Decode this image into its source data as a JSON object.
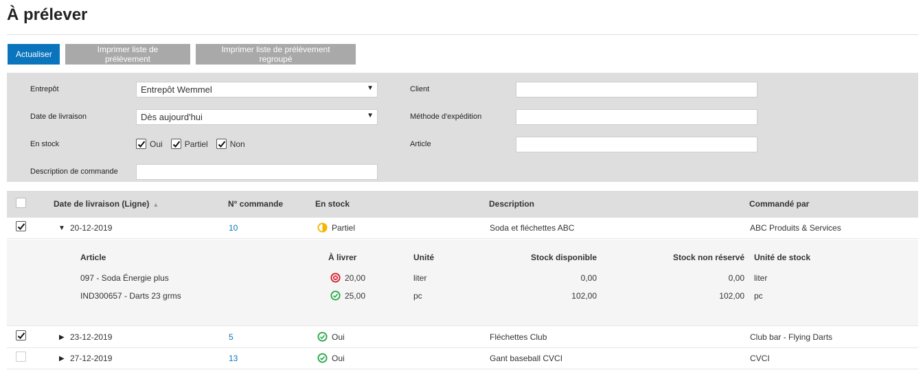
{
  "page": {
    "title": "À prélever"
  },
  "toolbar": {
    "refresh_label": "Actualiser",
    "print_label": "Imprimer liste de prélèvement",
    "print_grouped_label": "Imprimer liste de prélèvement regroupé"
  },
  "filters": {
    "warehouse": {
      "label": "Entrepôt",
      "value": "Entrepôt Wemmel"
    },
    "delivery_date": {
      "label": "Date de livraison",
      "value": "Dès aujourd'hui"
    },
    "in_stock": {
      "label": "En stock",
      "options": [
        {
          "label": "Oui",
          "checked": true
        },
        {
          "label": "Partiel",
          "checked": true
        },
        {
          "label": "Non",
          "checked": true
        }
      ]
    },
    "order_description": {
      "label": "Description de commande",
      "value": ""
    },
    "customer": {
      "label": "Client",
      "value": ""
    },
    "shipping_method": {
      "label": "Méthode d'expédition",
      "value": ""
    },
    "item": {
      "label": "Article",
      "value": ""
    }
  },
  "table": {
    "columns": {
      "delivery_date": "Date de livraison (Ligne)",
      "order_no": "N° commande",
      "in_stock": "En stock",
      "description": "Description",
      "ordered_by": "Commandé par"
    },
    "rows": [
      {
        "checked": true,
        "expanded": true,
        "date": "20-12-2019",
        "order": "10",
        "stock": "Partiel",
        "description": "Soda et fléchettes ABC",
        "ordered_by": "ABC Produits & Services"
      },
      {
        "checked": true,
        "expanded": false,
        "date": "23-12-2019",
        "order": "5",
        "stock": "Oui",
        "description": "Fléchettes Club",
        "ordered_by": "Club bar - Flying Darts"
      },
      {
        "checked": false,
        "expanded": false,
        "date": "27-12-2019",
        "order": "13",
        "stock": "Oui",
        "description": "Gant baseball CVCI",
        "ordered_by": "CVCI"
      }
    ],
    "detail": {
      "columns": {
        "item": "Article",
        "to_deliver": "À livrer",
        "unit": "Unité",
        "available": "Stock disponible",
        "unreserved": "Stock non réservé",
        "stock_unit": "Unité de stock"
      },
      "lines": [
        {
          "item": "097 - Soda Énergie plus",
          "to_deliver": "20,00",
          "status": "error",
          "unit": "liter",
          "available": "0,00",
          "unreserved": "0,00",
          "stock_unit": "liter"
        },
        {
          "item": "IND300657 - Darts 23 grms",
          "to_deliver": "25,00",
          "status": "ok",
          "unit": "pc",
          "available": "102,00",
          "unreserved": "102,00",
          "stock_unit": "pc"
        }
      ]
    }
  },
  "colors": {
    "accent": "#0a74bd",
    "ok": "#2aa84a",
    "error": "#d0202e",
    "partial": "#f2b705"
  },
  "icons": {
    "sort": "triangle-up-icon",
    "expand": "caret-right-icon",
    "collapse": "caret-down-icon"
  }
}
